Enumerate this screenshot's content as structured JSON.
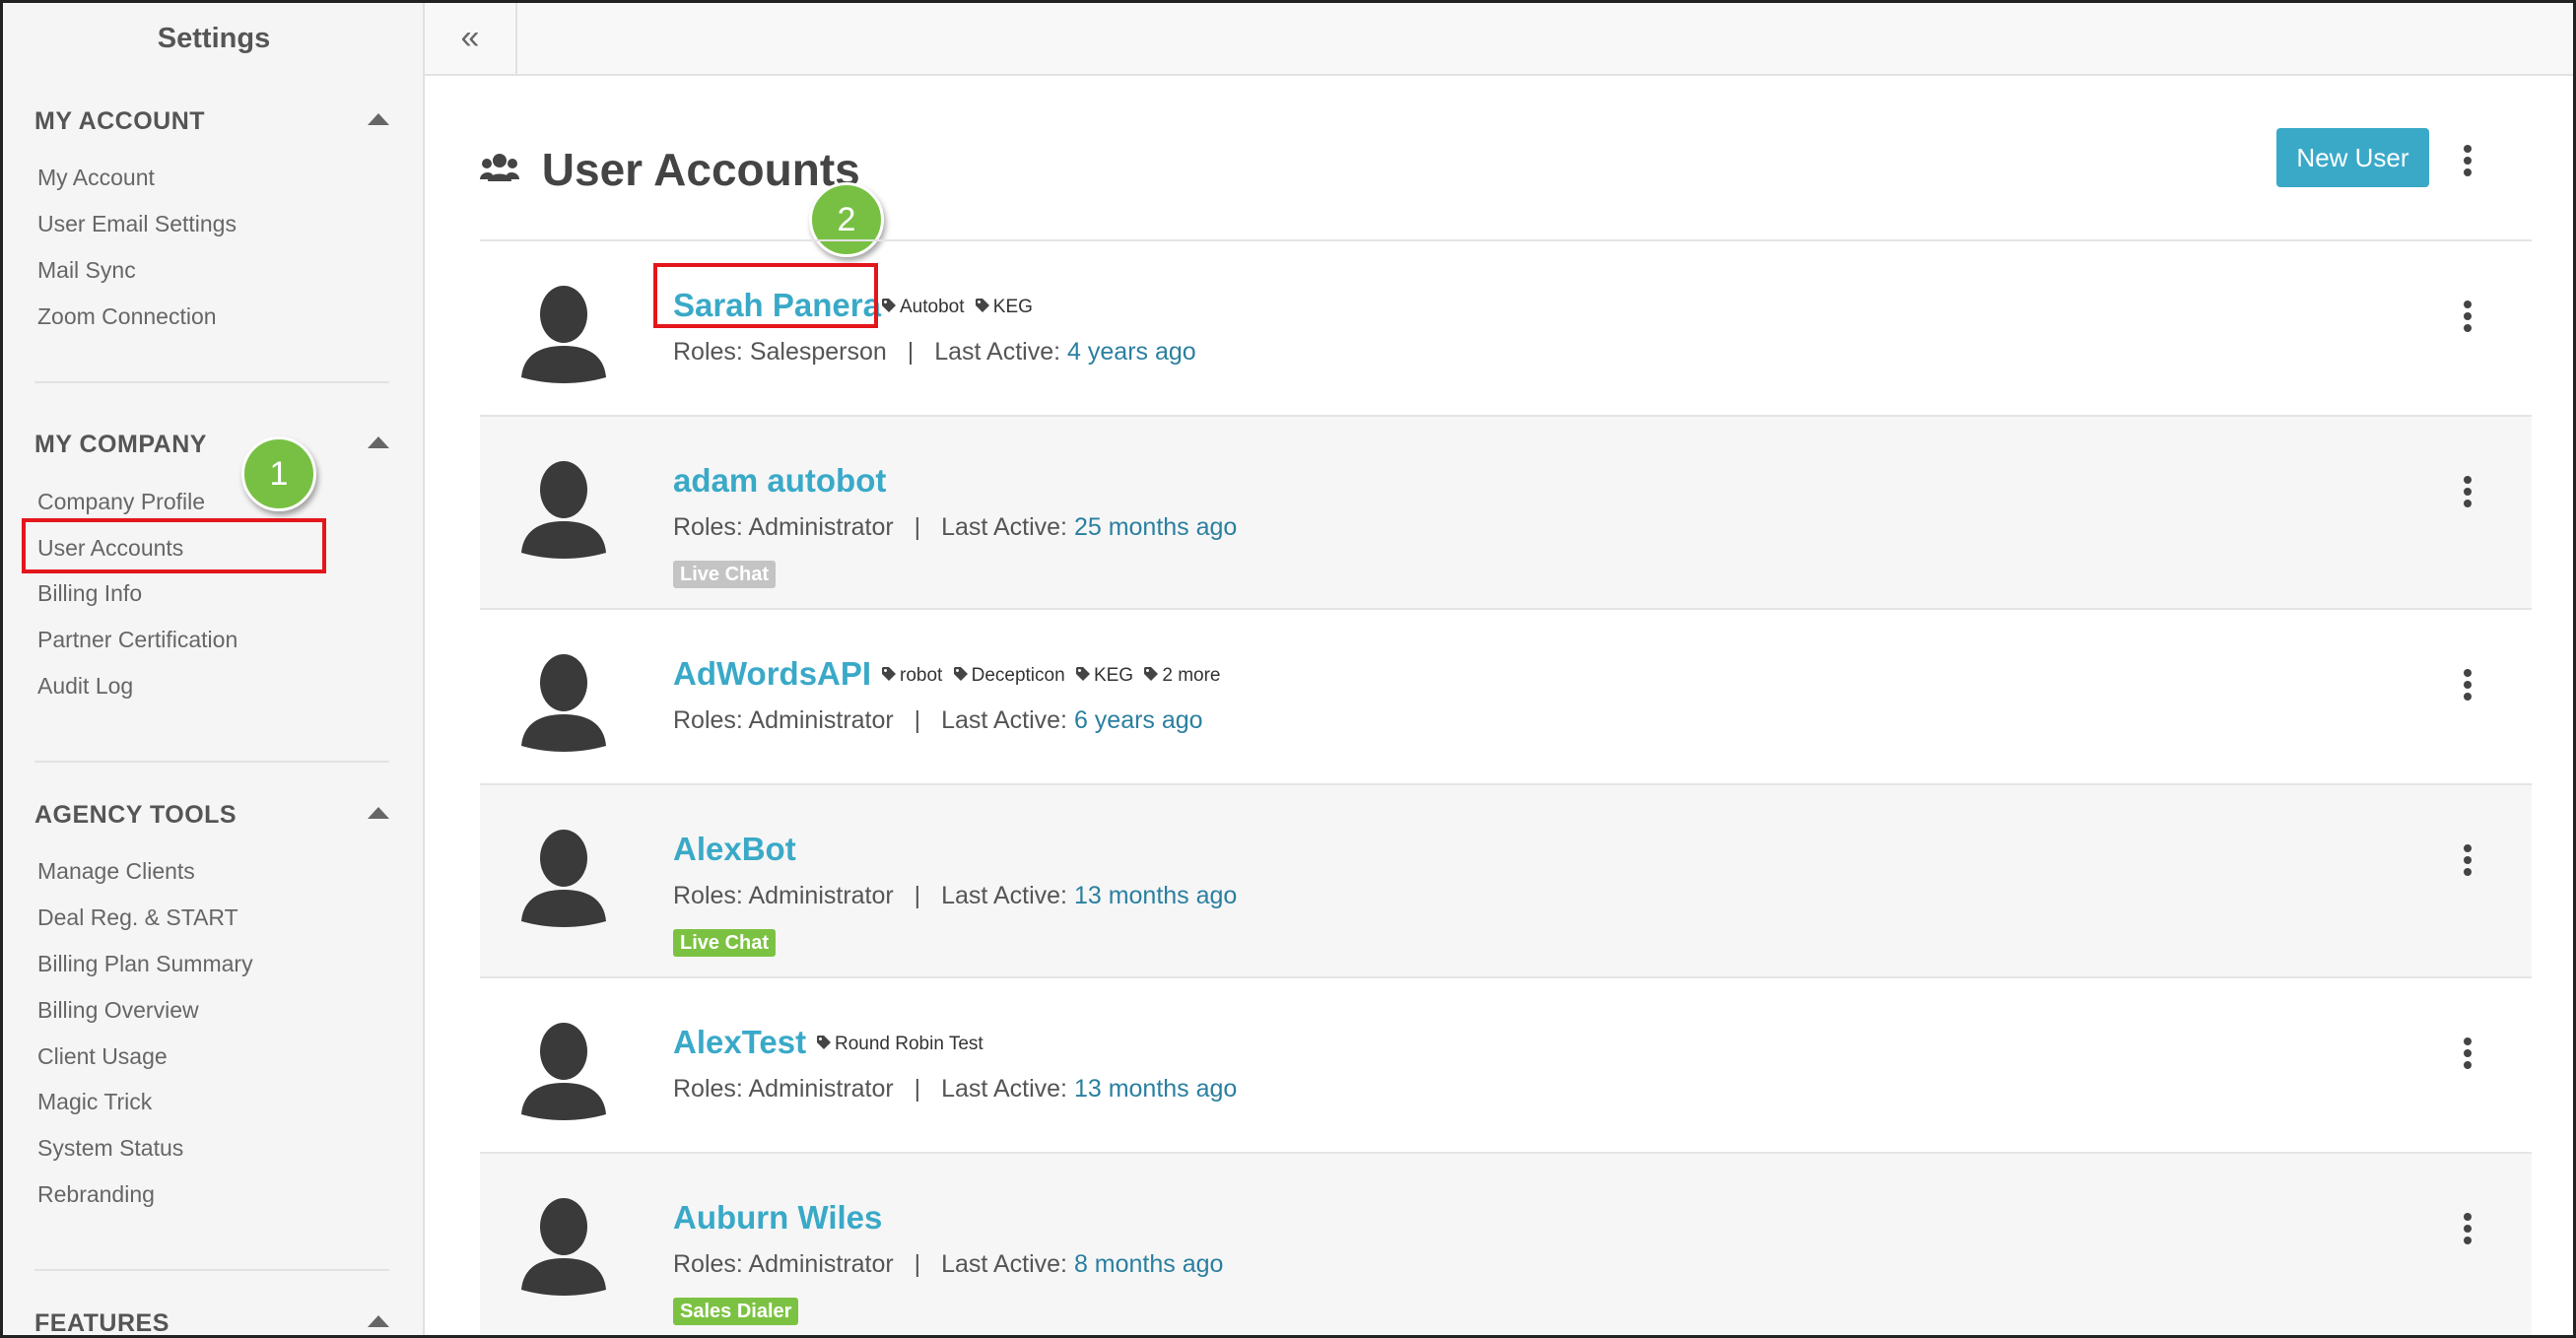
{
  "sidebar": {
    "title": "Settings",
    "sections": [
      {
        "heading": "MY ACCOUNT",
        "items": [
          "My Account",
          "User Email Settings",
          "Mail Sync",
          "Zoom Connection"
        ]
      },
      {
        "heading": "MY COMPANY",
        "items": [
          "Company Profile",
          "User Accounts",
          "Billing Info",
          "Partner Certification",
          "Audit Log"
        ]
      },
      {
        "heading": "AGENCY TOOLS",
        "items": [
          "Manage Clients",
          "Deal Reg. & START",
          "Billing Plan Summary",
          "Billing Overview",
          "Client Usage",
          "Magic Trick",
          "System Status",
          "Rebranding"
        ]
      },
      {
        "heading": "FEATURES",
        "items": []
      }
    ]
  },
  "callouts": {
    "step1": "1",
    "step2": "2"
  },
  "topbar": {
    "collapse_glyph": "«"
  },
  "main": {
    "title": "User Accounts",
    "new_user_label": "New User",
    "roles_label": "Roles:",
    "last_active_label": "Last Active:",
    "separator": "|",
    "users": [
      {
        "name": "Sarah Panera",
        "tags": [
          "Autobot",
          "KEG"
        ],
        "roles": "Salesperson",
        "last_active": "4 years ago",
        "badge": ""
      },
      {
        "name": "adam autobot",
        "tags": [],
        "roles": "Administrator",
        "last_active": "25 months ago",
        "badge": "Live Chat"
      },
      {
        "name": "AdWordsAPI",
        "tags": [
          "robot",
          "Decepticon",
          "KEG",
          "2 more"
        ],
        "roles": "Administrator",
        "last_active": "6 years ago",
        "badge": ""
      },
      {
        "name": "AlexBot",
        "tags": [],
        "roles": "Administrator",
        "last_active": "13 months ago",
        "badge": "Live Chat"
      },
      {
        "name": "AlexTest",
        "tags": [
          "Round Robin Test"
        ],
        "roles": "Administrator",
        "last_active": "13 months ago",
        "badge": ""
      },
      {
        "name": "Auburn Wiles",
        "tags": [],
        "roles": "Administrator",
        "last_active": "8 months ago",
        "badge": "Sales Dialer"
      }
    ]
  },
  "colors": {
    "accent": "#3aa9c8",
    "link_value": "#2a7fa0",
    "callout_green": "#77c043",
    "highlight_red": "#e3161c",
    "badge_gray": "#c4c4c4",
    "badge_green": "#7cc242"
  }
}
